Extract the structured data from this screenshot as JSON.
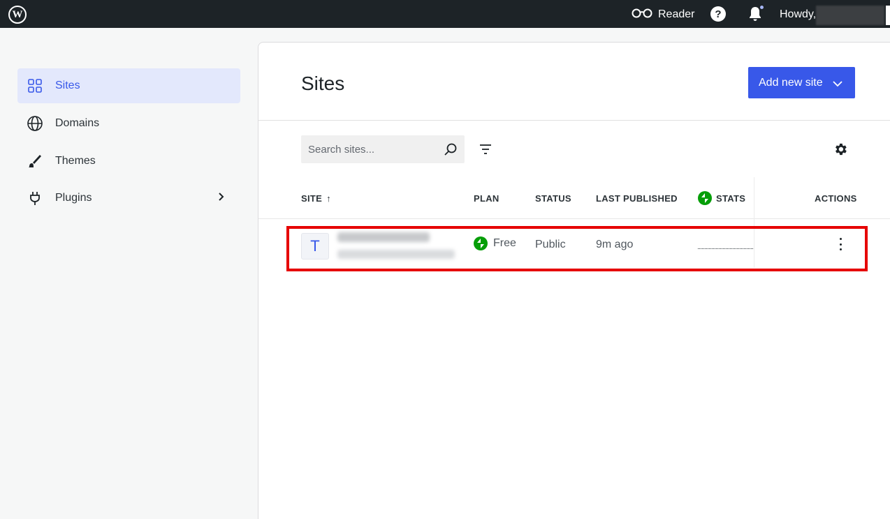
{
  "masterbar": {
    "reader_label": "Reader",
    "howdy_label": "Howdy,",
    "help_glyph": "?"
  },
  "sidebar": {
    "items": [
      {
        "label": "Sites",
        "icon": "grid-icon",
        "active": true
      },
      {
        "label": "Domains",
        "icon": "globe-icon"
      },
      {
        "label": "Themes",
        "icon": "brush-icon"
      },
      {
        "label": "Plugins",
        "icon": "plug-icon",
        "has_chevron": true
      }
    ]
  },
  "main": {
    "title": "Sites",
    "add_button_label": "Add new site",
    "search_placeholder": "Search sites...",
    "table": {
      "columns": {
        "site": "SITE",
        "site_sort": "↑",
        "plan": "PLAN",
        "status": "STATUS",
        "last_published": "LAST PUBLISHED",
        "stats": "STATS",
        "actions": "ACTIONS"
      },
      "rows": [
        {
          "avatar_letter": "T",
          "plan": "Free",
          "status": "Public",
          "last_published": "9m ago"
        }
      ]
    }
  },
  "colors": {
    "accent": "#3858e9",
    "masterbar": "#1d2327",
    "jetpack_green": "#069e08",
    "highlight_red": "#e60000",
    "active_nav_bg": "#e3e8fc"
  }
}
